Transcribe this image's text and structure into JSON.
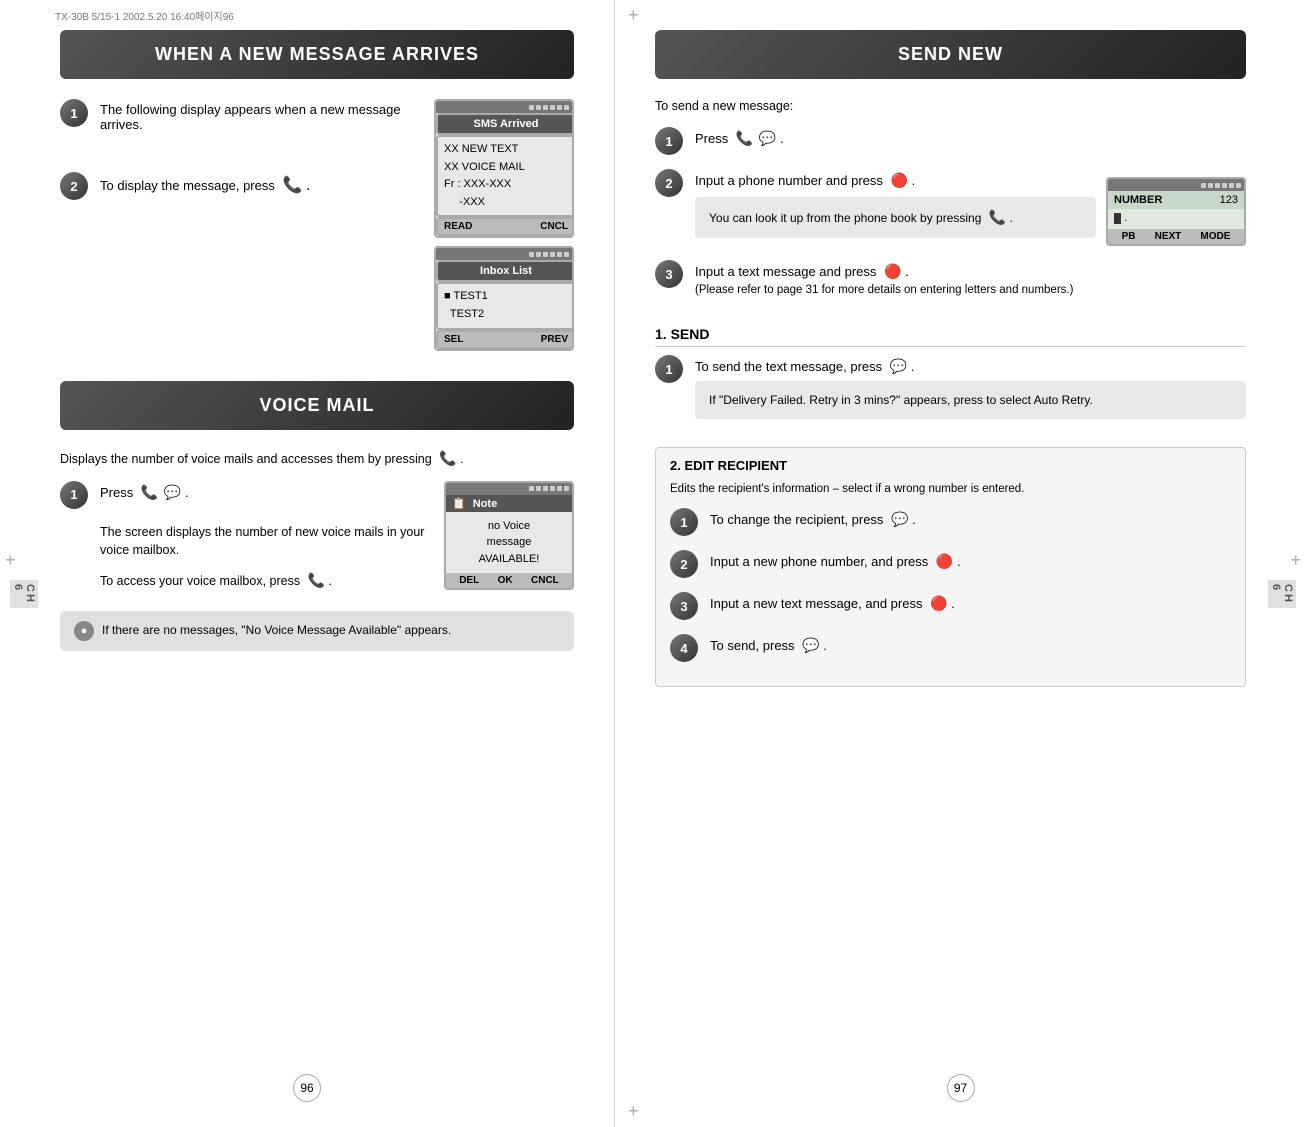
{
  "meta": {
    "top_left_text": "TX-30B 5/15-1  2002.5.20  16:40페이지96",
    "crosshairs_count": 4
  },
  "left_page": {
    "section1": {
      "header": "WHEN A NEW MESSAGE ARRIVES",
      "step1": {
        "number": "1",
        "text": "The following display appears when a new message arrives."
      },
      "step2": {
        "number": "2",
        "text": "To display the message, press"
      },
      "sms_screen": {
        "status_bar_icons": [
          "▪",
          "▪",
          "▪",
          "▪",
          "▪",
          "▪"
        ],
        "header": "SMS Arrived",
        "lines": [
          "XX NEW TEXT",
          "XX VOICE MAIL",
          "Fr : XXX-XXX",
          "     -XXX"
        ],
        "footer_left": "READ",
        "footer_right": "CNCL"
      },
      "inbox_screen": {
        "status_bar_icons": [
          "▪",
          "▪",
          "▪",
          "▪",
          "▪",
          "▪"
        ],
        "header": "Inbox List",
        "lines": [
          "■ TEST1",
          "  TEST2"
        ],
        "footer_left": "SEL",
        "footer_right": "PREV"
      }
    },
    "section2": {
      "header": "VOICE MAIL",
      "intro": "Displays the number of voice mails and accesses them by pressing",
      "step1": {
        "number": "1",
        "text": "Press"
      },
      "step1_detail": "The screen displays the number of new voice mails in your voice mailbox.",
      "step1_access": "To access your voice mailbox, press",
      "note_screen": {
        "header": "Note",
        "body": "no Voice\nmessage\nAVAILABLE!",
        "footer": [
          "DEL",
          "OK",
          "CNCL"
        ]
      },
      "warning": "If there are no messages, \"No Voice Message Available\" appears."
    },
    "page_number": "96"
  },
  "right_page": {
    "section_header": "SEND NEW",
    "intro": "To send a new message:",
    "step1": {
      "number": "1",
      "text": "Press"
    },
    "step2": {
      "number": "2",
      "text": "Input a phone number and press",
      "info": "You can look it up from the phone book by pressing"
    },
    "step3": {
      "number": "3",
      "text": "Input a text message and press",
      "note": "(Please refer to page 31 for more details on entering letters and numbers.)"
    },
    "number_screen": {
      "status_icons": [
        "▪",
        "▪",
        "▪",
        "▪",
        "▪",
        "▪"
      ],
      "row1_label": "NUMBER",
      "row1_value": "123",
      "row2_content": "▌ .",
      "footer": [
        "PB",
        "NEXT",
        "MODE"
      ]
    },
    "send_section": {
      "title": "1. SEND",
      "step1": {
        "number": "1",
        "text": "To send the text message, press"
      },
      "info": "If \"Delivery Failed. Retry in 3 mins?\" appears, press    to select Auto Retry."
    },
    "edit_section": {
      "title": "2. EDIT RECIPIENT",
      "intro": "Edits the recipient's information – select if a wrong number is entered.",
      "step1": {
        "number": "1",
        "text": "To change the recipient, press"
      },
      "step2": {
        "number": "2",
        "text": "Input a new phone number, and press"
      },
      "step3": {
        "number": "3",
        "text": "Input a new text message, and press"
      },
      "step4": {
        "number": "4",
        "text": "To send, press"
      }
    },
    "page_number": "97"
  },
  "ch_label": "CH\n6",
  "icons": {
    "phone_send": "☎",
    "phone_end": "☎",
    "circle_small": "●",
    "arrow": "→"
  }
}
